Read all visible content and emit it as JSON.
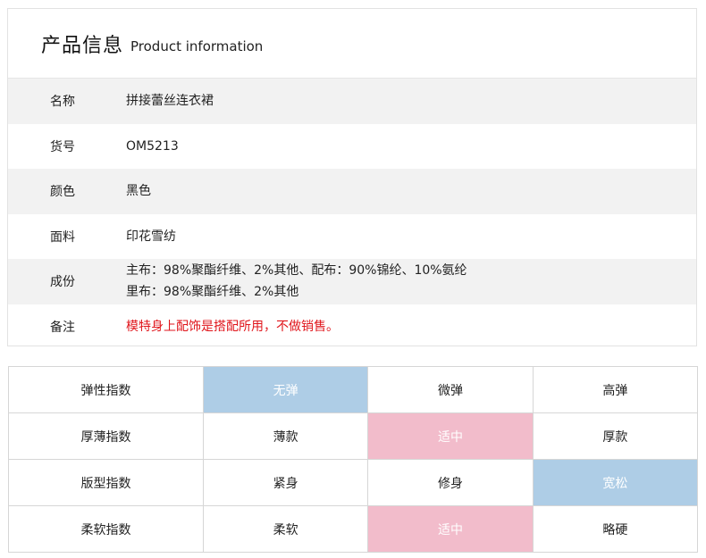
{
  "header": {
    "title_cn": "产品信息",
    "title_en": "Product information"
  },
  "info_rows": [
    {
      "label": "名称",
      "value": "拼接蕾丝连衣裙"
    },
    {
      "label": "货号",
      "value": "OM5213"
    },
    {
      "label": "颜色",
      "value": "黑色"
    },
    {
      "label": "面料",
      "value": "印花雪纺"
    },
    {
      "label": "成份",
      "line1": "主布：98%聚酯纤维、2%其他、配布：90%锦纶、10%氨纶",
      "line2": "里布：98%聚酯纤维、2%其他"
    },
    {
      "label": "备注",
      "value": "模特身上配饰是搭配所用，不做销售。"
    }
  ],
  "colors": {
    "note_red": "#e0161c",
    "selected_blue": "#aecde6",
    "selected_pink": "#f2bccb"
  },
  "index_rows": [
    {
      "label": "弹性指数",
      "options": [
        "无弹",
        "微弹",
        "高弹"
      ],
      "selected_index": 0
    },
    {
      "label": "厚薄指数",
      "options": [
        "薄款",
        "适中",
        "厚款"
      ],
      "selected_index": 1
    },
    {
      "label": "版型指数",
      "options": [
        "紧身",
        "修身",
        "宽松"
      ],
      "selected_index": 2
    },
    {
      "label": "柔软指数",
      "options": [
        "柔软",
        "适中",
        "略硬"
      ],
      "selected_index": 1
    }
  ]
}
